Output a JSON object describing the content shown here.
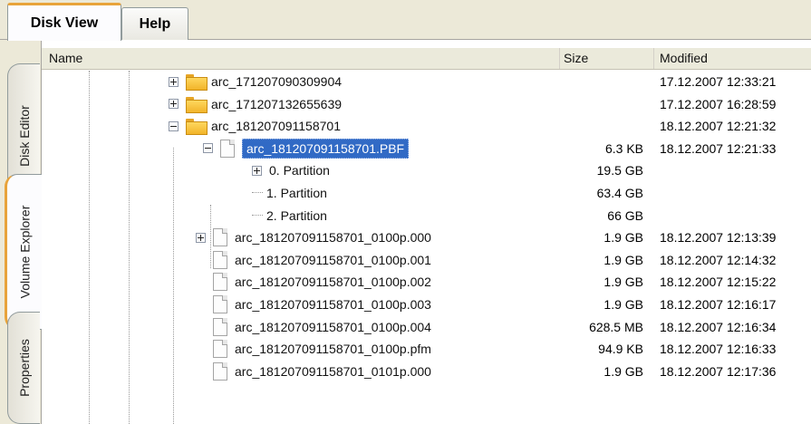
{
  "tabs": [
    {
      "label": "Disk View"
    },
    {
      "label": "Help"
    }
  ],
  "side_tabs": [
    {
      "label": "Disk Editor"
    },
    {
      "label": "Volume Explorer"
    },
    {
      "label": "Properties"
    }
  ],
  "columns": {
    "name": "Name",
    "size": "Size",
    "modified": "Modified"
  },
  "rows": [
    {
      "name": "arc_171207090309904",
      "size": "",
      "modified": "17.12.2007 12:33:21",
      "icon": "folder-icon",
      "expander": "plus"
    },
    {
      "name": "arc_171207132655639",
      "size": "",
      "modified": "17.12.2007 16:28:59",
      "icon": "folder-icon",
      "expander": "plus"
    },
    {
      "name": "arc_181207091158701",
      "size": "",
      "modified": "18.12.2007 12:21:32",
      "icon": "folder-icon",
      "expander": "minus"
    },
    {
      "name": "arc_181207091158701.PBF",
      "size": "6.3 KB",
      "modified": "18.12.2007 12:21:33",
      "icon": "file-icon",
      "expander": "minus",
      "selected": true
    },
    {
      "name": "0. Partition",
      "size": "19.5 GB",
      "modified": "",
      "icon": "",
      "expander": "plus"
    },
    {
      "name": "1. Partition",
      "size": "63.4 GB",
      "modified": "",
      "icon": "",
      "expander": "none"
    },
    {
      "name": "2. Partition",
      "size": "66 GB",
      "modified": "",
      "icon": "",
      "expander": "none"
    },
    {
      "name": "arc_181207091158701_0100p.000",
      "size": "1.9 GB",
      "modified": "18.12.2007 12:13:39",
      "icon": "file-icon",
      "expander": "plus"
    },
    {
      "name": "arc_181207091158701_0100p.001",
      "size": "1.9 GB",
      "modified": "18.12.2007 12:14:32",
      "icon": "file-icon",
      "expander": "none"
    },
    {
      "name": "arc_181207091158701_0100p.002",
      "size": "1.9 GB",
      "modified": "18.12.2007 12:15:22",
      "icon": "file-icon",
      "expander": "none"
    },
    {
      "name": "arc_181207091158701_0100p.003",
      "size": "1.9 GB",
      "modified": "18.12.2007 12:16:17",
      "icon": "file-icon",
      "expander": "none"
    },
    {
      "name": "arc_181207091158701_0100p.004",
      "size": "628.5 MB",
      "modified": "18.12.2007 12:16:34",
      "icon": "file-icon",
      "expander": "none"
    },
    {
      "name": "arc_181207091158701_0100p.pfm",
      "size": "94.9 KB",
      "modified": "18.12.2007 12:16:33",
      "icon": "file-icon",
      "expander": "none"
    },
    {
      "name": "arc_181207091158701_0101p.000",
      "size": "1.9 GB",
      "modified": "18.12.2007 12:17:36",
      "icon": "file-icon",
      "expander": "none"
    }
  ],
  "colors": {
    "selection": "#316ac5",
    "tab_accent": "#e8a33a",
    "chrome": "#ece9d8"
  }
}
